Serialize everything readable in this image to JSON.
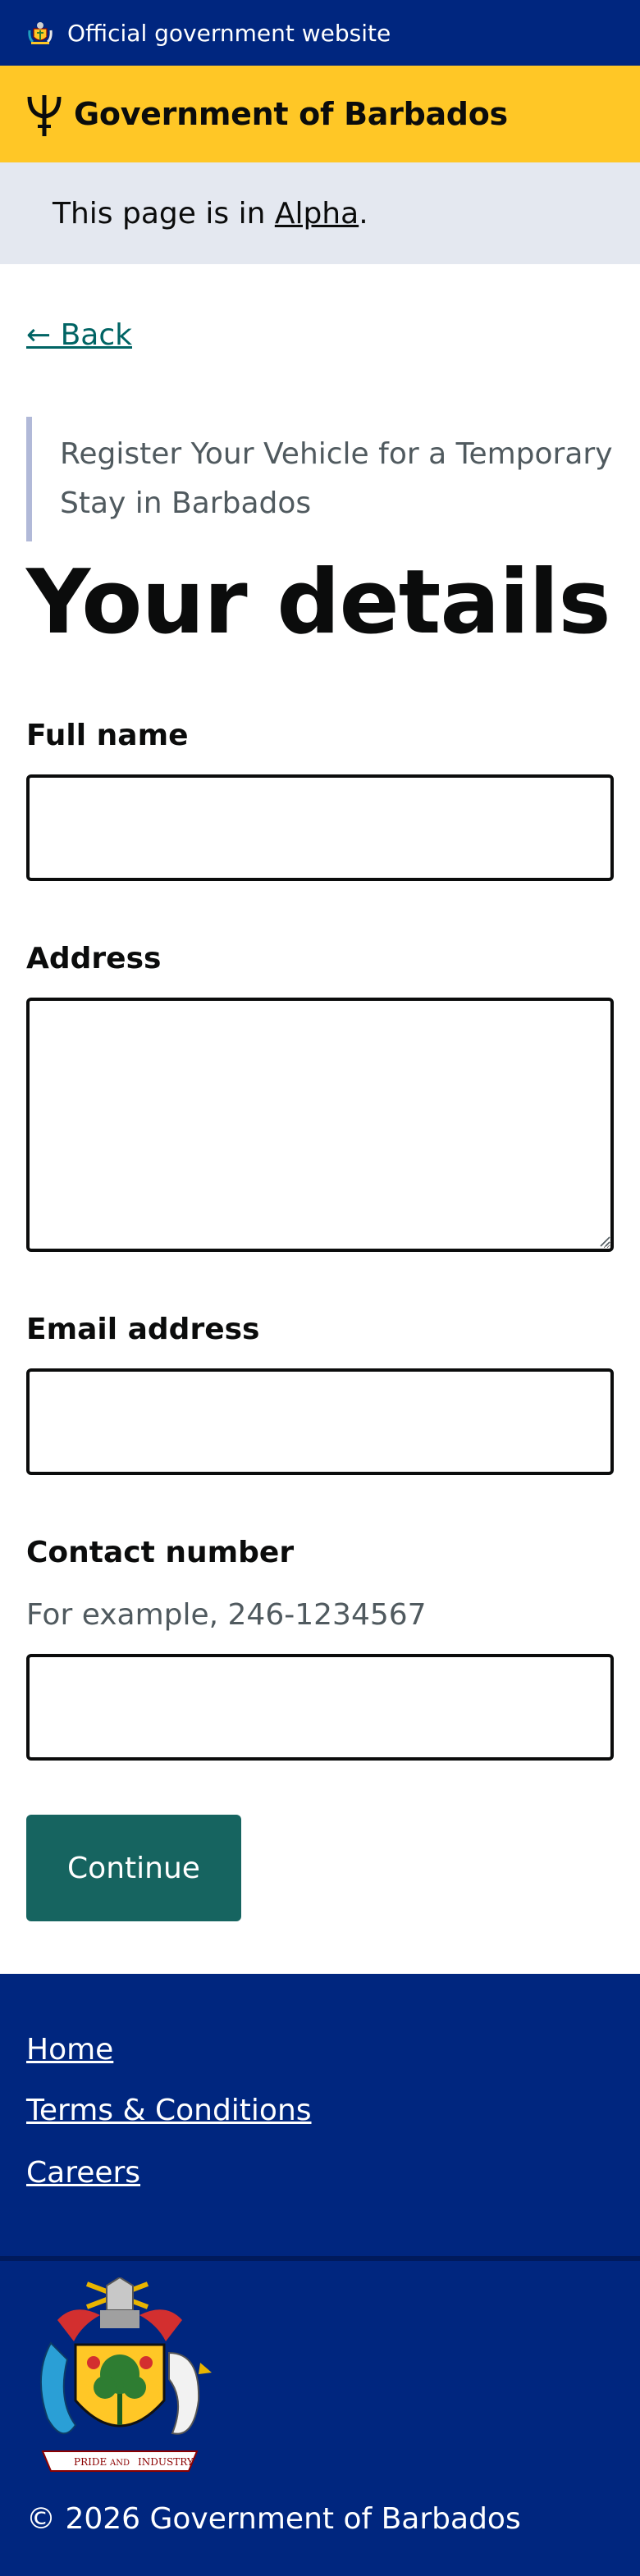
{
  "top_strip": {
    "text": "Official government website",
    "icon": "crest-icon"
  },
  "header": {
    "title": "Government of Barbados",
    "logo_icon": "trident-icon"
  },
  "phase_banner": {
    "prefix": "This page is in ",
    "phase": "Alpha",
    "suffix": "."
  },
  "back_link": "← Back",
  "service_caption": "Register Your Vehicle for a Temporary Stay in Barbados",
  "page_heading": "Your details",
  "form": {
    "full_name": {
      "label": "Full name",
      "value": ""
    },
    "address": {
      "label": "Address",
      "value": ""
    },
    "email": {
      "label": "Email address",
      "value": ""
    },
    "contact": {
      "label": "Contact number",
      "hint": "For example, 246-1234567",
      "value": ""
    },
    "continue_label": "Continue"
  },
  "footer": {
    "links": [
      "Home",
      "Terms & Conditions",
      "Careers"
    ],
    "coat_motto_left": "PRIDE",
    "coat_motto_mid": "AND",
    "coat_motto_right": "INDUSTRY",
    "copyright": "© 2026 Government of Barbados"
  },
  "colors": {
    "navy": "#00267f",
    "gold": "#ffc726",
    "teal": "#166460",
    "banner_grey": "#e4e8f0"
  }
}
